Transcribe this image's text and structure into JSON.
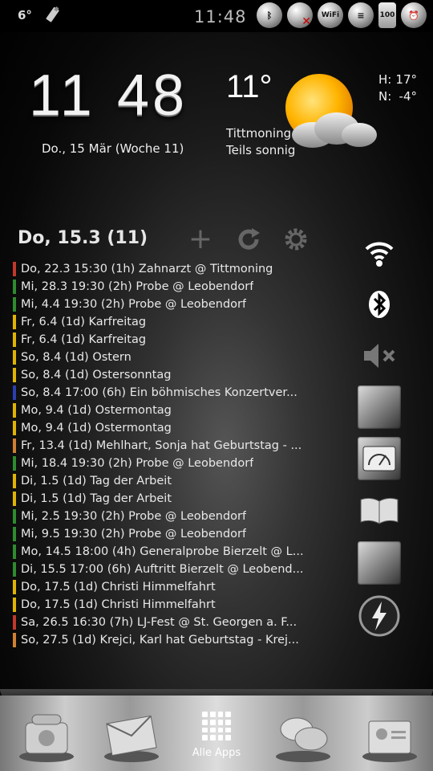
{
  "statusbar": {
    "temp_small": "6°",
    "time": "11:48",
    "battery": "100",
    "icons": [
      "usb-icon",
      "bluetooth-icon",
      "alarm-off-icon",
      "wifi-icon",
      "signal-icon",
      "battery-icon",
      "alarm-clock-icon"
    ]
  },
  "clock": {
    "hours": "11",
    "minutes": "48",
    "date": "Do., 15 Mär (Woche 11)"
  },
  "weather": {
    "temp": "11°",
    "location": "Tittmoning",
    "condition": "Teils sonnig",
    "high_label": "H:",
    "high": "17°",
    "low_label": "N:",
    "low": "-4°"
  },
  "agenda": {
    "header": "Do, 15.3 (11)",
    "events": [
      {
        "text": "Do, 22.3 15:30 (1h) Zahnarzt @ Tittmoning",
        "color": "#c0392b"
      },
      {
        "text": "Mi, 28.3 19:30 (2h) Probe @ Leobendorf",
        "color": "#2e8b2e"
      },
      {
        "text": "Mi, 4.4 19:30 (2h) Probe @ Leobendorf",
        "color": "#2e8b2e"
      },
      {
        "text": "Fr, 6.4 (1d) Karfreitag",
        "color": "#e0b400"
      },
      {
        "text": "Fr, 6.4 (1d) Karfreitag",
        "color": "#e0b400"
      },
      {
        "text": "So, 8.4 (1d) Ostern",
        "color": "#e0b400"
      },
      {
        "text": "So, 8.4 (1d) Ostersonntag",
        "color": "#e0b400"
      },
      {
        "text": "So, 8.4 17:00 (6h) Ein böhmisches Konzertver...",
        "color": "#2a3fb0"
      },
      {
        "text": "Mo, 9.4 (1d) Ostermontag",
        "color": "#e0b400"
      },
      {
        "text": "Mo, 9.4 (1d) Ostermontag",
        "color": "#e0b400"
      },
      {
        "text": "Fr, 13.4 (1d) Mehlhart, Sonja hat Geburtstag - ...",
        "color": "#d08030"
      },
      {
        "text": "Mi, 18.4 19:30 (2h) Probe @ Leobendorf",
        "color": "#2e8b2e"
      },
      {
        "text": "Di, 1.5 (1d) Tag der Arbeit",
        "color": "#e0b400"
      },
      {
        "text": "Di, 1.5 (1d) Tag der Arbeit",
        "color": "#e0b400"
      },
      {
        "text": "Mi, 2.5 19:30 (2h) Probe @ Leobendorf",
        "color": "#2e8b2e"
      },
      {
        "text": "Mi, 9.5 19:30 (2h) Probe @ Leobendorf",
        "color": "#2e8b2e"
      },
      {
        "text": "Mo, 14.5 18:00 (4h) Generalprobe Bierzelt @ L...",
        "color": "#2e8b2e"
      },
      {
        "text": "Di, 15.5 17:00 (6h) Auftritt Bierzelt @ Leobend...",
        "color": "#2e8b2e"
      },
      {
        "text": "Do, 17.5 (1d) Christi Himmelfahrt",
        "color": "#e0b400"
      },
      {
        "text": "Do, 17.5 (1d) Christi Himmelfahrt",
        "color": "#e0b400"
      },
      {
        "text": "Sa, 26.5 16:30 (7h) LJ-Fest @ St. Georgen a. F...",
        "color": "#c0392b"
      },
      {
        "text": "So, 27.5 (1d) Krejci, Karl hat Geburtstag - Krej...",
        "color": "#d08030"
      }
    ]
  },
  "dock": {
    "allapps_label": "Alle Apps"
  }
}
